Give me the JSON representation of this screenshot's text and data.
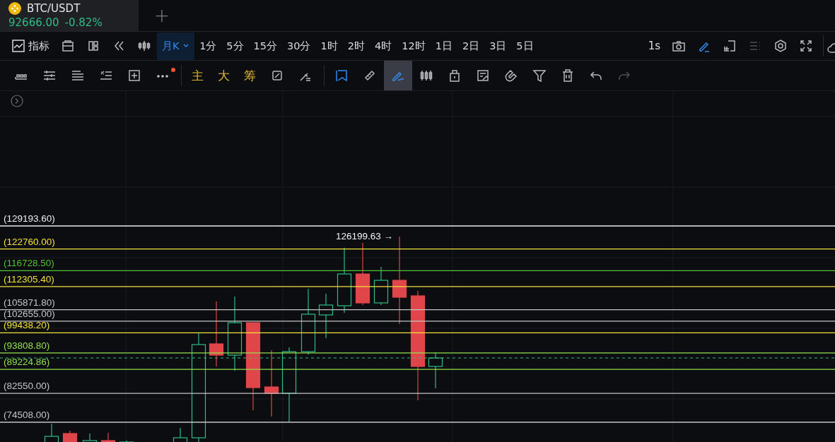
{
  "symbol_tab": {
    "symbol": "BTC/USDT",
    "price": "92666.00",
    "change": "-0.82%",
    "add_tab": "+"
  },
  "toolbar": {
    "indicators": "指标",
    "intervals": [
      {
        "label": "月K",
        "selected": true
      },
      {
        "label": "1分",
        "selected": false
      },
      {
        "label": "5分",
        "selected": false
      },
      {
        "label": "15分",
        "selected": false
      },
      {
        "label": "30分",
        "selected": false
      },
      {
        "label": "1时",
        "selected": false
      },
      {
        "label": "2时",
        "selected": false
      },
      {
        "label": "4时",
        "selected": false
      },
      {
        "label": "12时",
        "selected": false
      },
      {
        "label": "1日",
        "selected": false
      },
      {
        "label": "2日",
        "selected": false
      },
      {
        "label": "3日",
        "selected": false
      },
      {
        "label": "5日",
        "selected": false
      }
    ],
    "realtime": "1s"
  },
  "drawing_toolbar": {
    "overlays": [
      "主",
      "大",
      "筹"
    ],
    "draw_mode_selected": true
  },
  "level_lines": [
    {
      "label": "(129193.60)",
      "color": "#ececec"
    },
    {
      "label": "(122760.00)",
      "color": "#f2e23c"
    },
    {
      "label": "(116728.50)",
      "color": "#52c234"
    },
    {
      "label": "(112305.40)",
      "color": "#f2e23c"
    },
    {
      "label": "(105871.80)",
      "color": "#c4c4c4"
    },
    {
      "label": "(102655.00)",
      "color": "#c4c4c4"
    },
    {
      "label": "(99438.20)",
      "color": "#f2e23c"
    },
    {
      "label": "(93808.80)",
      "color": "#93e04e"
    },
    {
      "label": "(89224.86)",
      "color": "#93e04e"
    },
    {
      "label": "(82550.00)",
      "color": "#c4c4c4"
    },
    {
      "label": "(74508.00)",
      "color": "#c4c4c4"
    }
  ],
  "peak_label": "126199.63 →"
}
